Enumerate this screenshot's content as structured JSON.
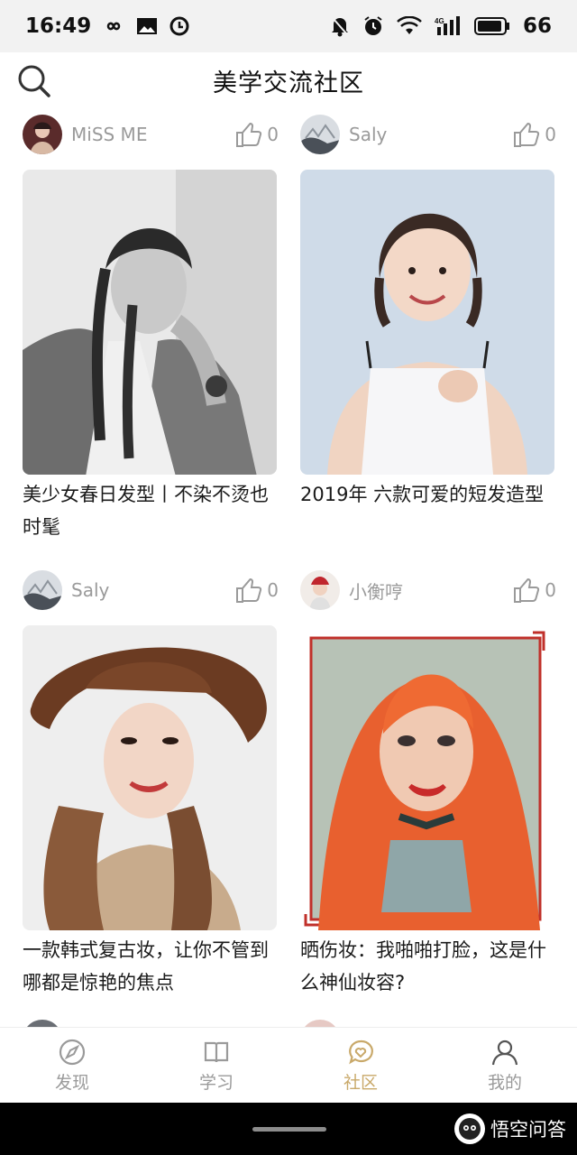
{
  "status_bar": {
    "time": "16:49",
    "battery": "66",
    "network": "4G"
  },
  "header": {
    "title": "美学交流社区"
  },
  "posts": [
    {
      "author": "MiSS ME",
      "likes": "0",
      "title": "美少女春日发型丨不染不烫也时髦",
      "image": "bw-braids-portrait"
    },
    {
      "author": "Saly",
      "likes": "0",
      "title": "2019年 六款可爱的短发造型",
      "image": "short-bob-portrait"
    },
    {
      "author": "Saly",
      "likes": "0",
      "title": " 一款韩式复古妆，让你不管到哪都是惊艳的焦点",
      "image": "brown-hat-portrait"
    },
    {
      "author": "小衡哼",
      "likes": "0",
      "title": "晒伤妆：我啪啪打脸，这是什么神仙妆容?",
      "image": "red-hair-portrait"
    }
  ],
  "bottom_nav": [
    {
      "label": "发现",
      "icon": "compass-icon",
      "active": false
    },
    {
      "label": "学习",
      "icon": "book-icon",
      "active": false
    },
    {
      "label": "社区",
      "icon": "chat-heart-icon",
      "active": true
    },
    {
      "label": "我的",
      "icon": "person-icon",
      "active": false
    }
  ],
  "watermark": "悟空问答",
  "colors": {
    "accent": "#c9a96a",
    "muted": "#9a9a9a",
    "status_bg": "#f2f2f2"
  }
}
